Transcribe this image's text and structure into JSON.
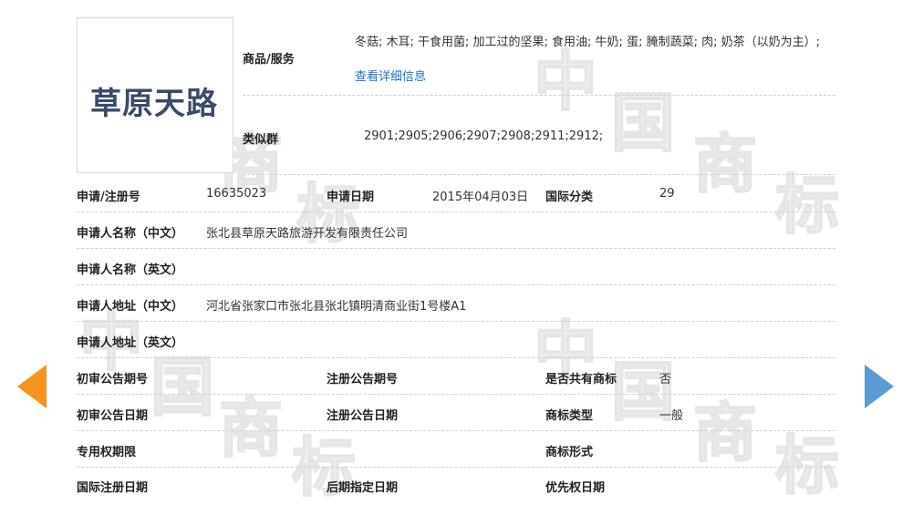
{
  "brand": {
    "logo_text": "草原天路"
  },
  "goods": {
    "label": "商品/服务",
    "text": "冬菇; 木耳; 干食用菌; 加工过的坚果; 食用油; 牛奶; 蛋; 腌制蔬菜; 肉; 奶茶（以奶为主）; ",
    "link": "查看详细信息"
  },
  "similar_group": {
    "label": "类似群",
    "value": "2901;2905;2906;2907;2908;2911;2912;"
  },
  "reg_number": {
    "label": "申请/注册号",
    "value": "16635023"
  },
  "app_date": {
    "label": "申请日期",
    "value": "2015年04月03日"
  },
  "intl_class": {
    "label": "国际分类",
    "value": "29"
  },
  "applicant_cn": {
    "label": "申请人名称（中文）",
    "value": "张北县草原天路旅游开发有限责任公司"
  },
  "applicant_en": {
    "label": "申请人名称（英文）",
    "value": ""
  },
  "address_cn": {
    "label": "申请人地址（中文）",
    "value": "河北省张家口市张北县张北镇明清商业街1号楼A1"
  },
  "address_en": {
    "label": "申请人地址（英文）",
    "value": ""
  },
  "prelim_pub_no": {
    "label": "初审公告期号",
    "value": ""
  },
  "reg_pub_no": {
    "label": "注册公告期号",
    "value": ""
  },
  "shared_mark": {
    "label": "是否共有商标",
    "value": "否"
  },
  "prelim_pub_date": {
    "label": "初审公告日期",
    "value": ""
  },
  "reg_pub_date": {
    "label": "注册公告日期",
    "value": ""
  },
  "mark_type": {
    "label": "商标类型",
    "value": "一般"
  },
  "exclusive_period": {
    "label": "专用权期限",
    "value": ""
  },
  "mark_form": {
    "label": "商标形式",
    "value": ""
  },
  "intl_reg_date": {
    "label": "国际注册日期",
    "value": ""
  },
  "later_date": {
    "label": "后期指定日期",
    "value": ""
  },
  "priority_date": {
    "label": "优先权日期",
    "value": ""
  },
  "watermark": {
    "chars": [
      "中",
      "国",
      "商",
      "标"
    ]
  },
  "nav": {
    "prev_icon": "arrow-left-icon",
    "next_icon": "arrow-right-icon"
  }
}
